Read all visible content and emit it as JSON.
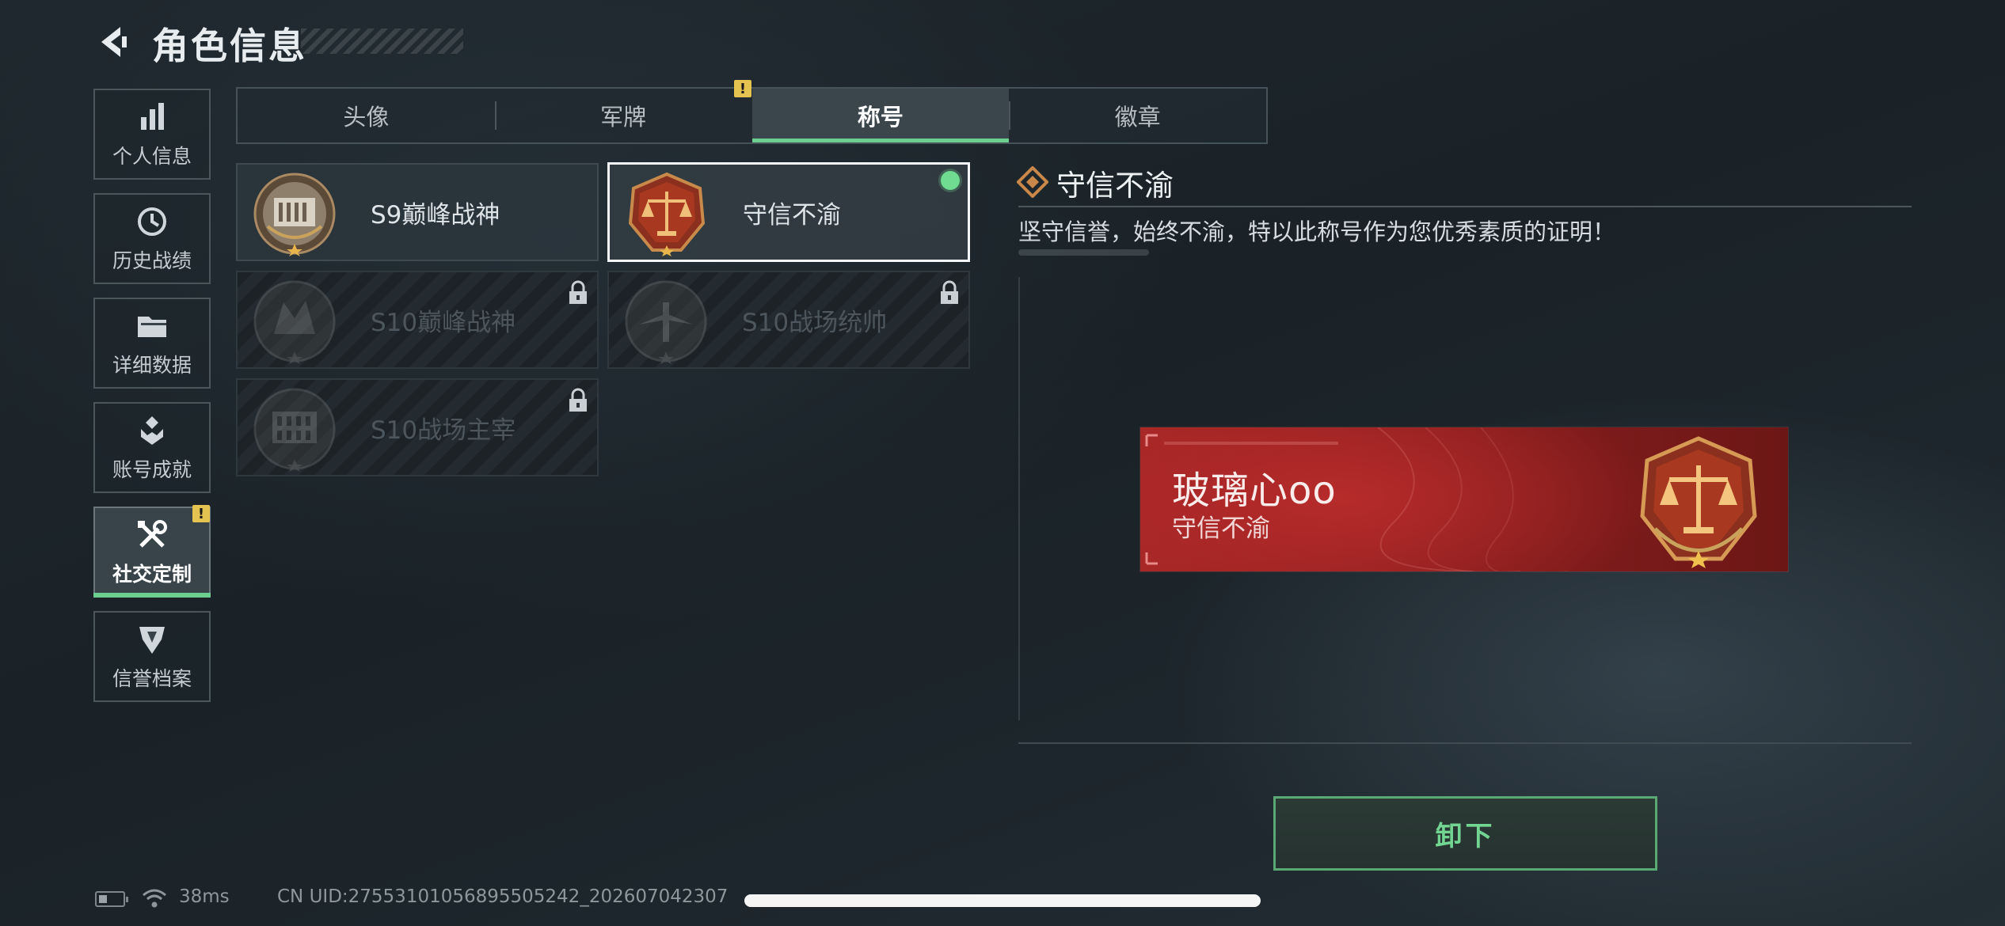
{
  "header": {
    "title": "角色信息",
    "back_icon": "back-arrow-icon"
  },
  "sidebar": {
    "items": [
      {
        "label": "个人信息",
        "icon": "bar-chart-icon",
        "active": false,
        "alert": false
      },
      {
        "label": "历史战绩",
        "icon": "history-clock-icon",
        "active": false,
        "alert": false
      },
      {
        "label": "详细数据",
        "icon": "folder-icon",
        "active": false,
        "alert": false
      },
      {
        "label": "账号成就",
        "icon": "achievement-medal-icon",
        "active": false,
        "alert": false
      },
      {
        "label": "社交定制",
        "icon": "tools-icon",
        "active": true,
        "alert": true
      },
      {
        "label": "信誉档案",
        "icon": "reputation-shield-icon",
        "active": false,
        "alert": false
      }
    ]
  },
  "tabs": [
    {
      "label": "头像",
      "active": false,
      "alert": false
    },
    {
      "label": "军牌",
      "active": false,
      "alert": true
    },
    {
      "label": "称号",
      "active": true,
      "alert": false
    },
    {
      "label": "徽章",
      "active": false,
      "alert": false
    }
  ],
  "titles": [
    {
      "name": "S9巅峰战神",
      "emblem": "fortress-emblem-icon",
      "locked": false,
      "selected": false,
      "equipped": false
    },
    {
      "name": "守信不渝",
      "emblem": "scales-emblem-icon",
      "locked": false,
      "selected": true,
      "equipped": true
    },
    {
      "name": "S10巅峰战神",
      "emblem": "fortress-emblem-icon",
      "locked": true,
      "selected": false,
      "equipped": false
    },
    {
      "name": "S10战场统帅",
      "emblem": "aircraft-emblem-icon",
      "locked": true,
      "selected": false,
      "equipped": false
    },
    {
      "name": "S10战场主宰",
      "emblem": "colosseum-emblem-icon",
      "locked": true,
      "selected": false,
      "equipped": false
    }
  ],
  "detail": {
    "title": "守信不渝",
    "description": "坚守信誉，始终不渝，特以此称号作为您优秀素质的证明！"
  },
  "banner": {
    "player_name": "玻璃心oo",
    "title": "守信不渝",
    "emblem": "scales-emblem-icon"
  },
  "actions": {
    "unequip_label": "卸下"
  },
  "status": {
    "ping": "38ms",
    "uid": "CN UID:27553101056895505242_202607042307"
  },
  "colors": {
    "accent": "#6ccf8f",
    "alert": "#e4c350",
    "banner_red": "#a52626",
    "bronze": "#c9884a"
  }
}
